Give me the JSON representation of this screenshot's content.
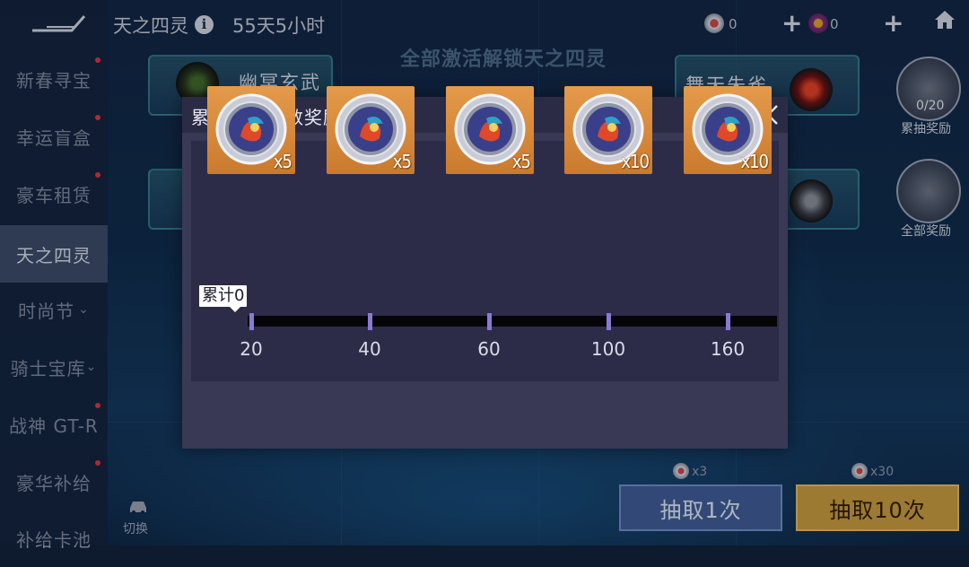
{
  "sidebar": {
    "items": [
      {
        "label": "新春寻宝",
        "dot": true
      },
      {
        "label": "幸运盲盒",
        "dot": true
      },
      {
        "label": "豪车租赁",
        "dot": true
      },
      {
        "label": "天之四灵",
        "active": true
      },
      {
        "label": "时尚节",
        "chevron": "⌄"
      },
      {
        "label": "骑士宝库",
        "chevron": "⌄"
      },
      {
        "label": "战神 GT-R",
        "dot": true
      },
      {
        "label": "豪华补给",
        "dot": true
      },
      {
        "label": "补给卡池"
      }
    ]
  },
  "header": {
    "title": "天之四灵",
    "countdown": "55天5小时",
    "currency_a": "0",
    "currency_b": "0",
    "plus": "+"
  },
  "background": {
    "banner": "全部激活解锁天之四灵",
    "beast_left": "幽冥玄武",
    "beast_right": "舞天朱雀",
    "cumulative_count": "0/20",
    "cumulative_label": "累抽奖励",
    "all_rewards_label": "全部奖励",
    "draw_one_cost": "x3",
    "draw_one_label": "抽取1次",
    "draw_ten_cost": "x30",
    "draw_ten_label": "抽取10次",
    "switch_label": "切换"
  },
  "modal": {
    "title": "累计抽奖次数奖励",
    "rewards": [
      {
        "qty": "x5",
        "icon": "ace-racer-coin"
      },
      {
        "qty": "x5",
        "icon": "ace-racer-coin"
      },
      {
        "qty": "x5",
        "icon": "ace-racer-coin"
      },
      {
        "qty": "x10",
        "icon": "ace-racer-coin"
      },
      {
        "qty": "x10",
        "icon": "ace-racer-coin"
      }
    ],
    "progress": {
      "label": "累计0",
      "current": 0,
      "max": 160,
      "milestones": [
        "20",
        "40",
        "60",
        "100",
        "160"
      ]
    }
  },
  "colors": {
    "accent": "#8a78d6",
    "modal_bg": "#393955",
    "reward_bg": "#d7893a"
  }
}
